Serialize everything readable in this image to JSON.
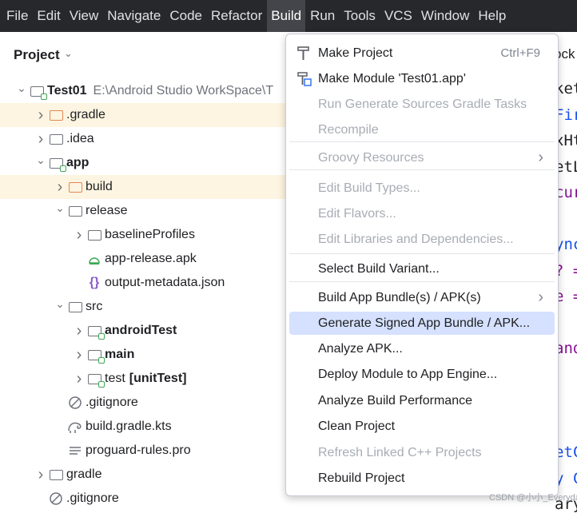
{
  "menubar": {
    "items": [
      "File",
      "Edit",
      "View",
      "Navigate",
      "Code",
      "Refactor",
      "Build",
      "Run",
      "Tools",
      "VCS",
      "Window",
      "Help"
    ],
    "active": "Build"
  },
  "project_panel": {
    "title": "Project",
    "tree": [
      {
        "label": "Test01",
        "path": "E:\\Android Studio WorkSpace\\T",
        "bold": true,
        "icon": "module-folder",
        "arrow": "down",
        "indent": 0,
        "highlight": false
      },
      {
        "label": ".gradle",
        "icon": "folder-orange",
        "arrow": "right",
        "indent": 1,
        "highlight": true
      },
      {
        "label": ".idea",
        "icon": "folder",
        "arrow": "right",
        "indent": 1,
        "highlight": false
      },
      {
        "label": "app",
        "bold": true,
        "icon": "module-folder",
        "arrow": "down",
        "indent": 1,
        "highlight": false
      },
      {
        "label": "build",
        "icon": "folder-orange",
        "arrow": "right",
        "indent": 2,
        "highlight": true
      },
      {
        "label": "release",
        "icon": "folder",
        "arrow": "down",
        "indent": 2,
        "highlight": false
      },
      {
        "label": "baselineProfiles",
        "icon": "folder",
        "arrow": "right",
        "indent": 3,
        "highlight": false
      },
      {
        "label": "app-release.apk",
        "icon": "apk-icon",
        "arrow": "",
        "indent": 3,
        "highlight": false
      },
      {
        "label": "output-metadata.json",
        "icon": "json-icon",
        "arrow": "",
        "indent": 3,
        "highlight": false
      },
      {
        "label": "src",
        "icon": "folder",
        "arrow": "down",
        "indent": 2,
        "highlight": false
      },
      {
        "label": "androidTest",
        "bold": true,
        "icon": "module-folder",
        "arrow": "right",
        "indent": 3,
        "highlight": false
      },
      {
        "label": "main",
        "bold": true,
        "icon": "module-folder",
        "arrow": "right",
        "indent": 3,
        "highlight": false
      },
      {
        "label": "test",
        "suffix": "[unitTest]",
        "icon": "module-folder",
        "arrow": "right",
        "indent": 3,
        "highlight": false
      },
      {
        "label": ".gitignore",
        "icon": "ignore-icon",
        "arrow": "",
        "indent": 2,
        "highlight": false
      },
      {
        "label": "build.gradle.kts",
        "icon": "gradle-icon",
        "arrow": "",
        "indent": 2,
        "highlight": false
      },
      {
        "label": "proguard-rules.pro",
        "icon": "text-file-icon",
        "arrow": "",
        "indent": 2,
        "highlight": false
      },
      {
        "label": "gradle",
        "icon": "folder",
        "arrow": "right",
        "indent": 1,
        "highlight": false
      },
      {
        "label": ".gitignore",
        "icon": "ignore-icon",
        "arrow": "",
        "indent": 1,
        "highlight": false
      }
    ]
  },
  "editor_peek": {
    "tab": "ock",
    "lines": [
      "ket",
      "Fir",
      "xHt",
      "etL",
      "cur",
      "",
      "ync",
      "? =",
      "e =",
      "",
      "and",
      "",
      "",
      "",
      "etC",
      "y C",
      "ary"
    ]
  },
  "build_menu": {
    "items": [
      {
        "label": "Make Project",
        "shortcut": "Ctrl+F9",
        "icon": "hammer-icon",
        "disabled": false
      },
      {
        "label": "Make Module 'Test01.app'",
        "icon": "make-module-icon",
        "disabled": false
      },
      {
        "label": "Run Generate Sources Gradle Tasks",
        "disabled": true
      },
      {
        "label": "Recompile",
        "disabled": true
      },
      {
        "sep": true
      },
      {
        "label": "Groovy Resources",
        "submenu": true,
        "disabled": true
      },
      {
        "sep": true
      },
      {
        "label": "Edit Build Types...",
        "disabled": true
      },
      {
        "label": "Edit Flavors...",
        "disabled": true
      },
      {
        "label": "Edit Libraries and Dependencies...",
        "disabled": true
      },
      {
        "sep": true
      },
      {
        "label": "Select Build Variant...",
        "disabled": false
      },
      {
        "sep": true
      },
      {
        "label": "Build App Bundle(s) / APK(s)",
        "submenu": true,
        "disabled": false
      },
      {
        "label": "Generate Signed App Bundle / APK...",
        "selected": true,
        "disabled": false
      },
      {
        "label": "Analyze APK...",
        "disabled": false
      },
      {
        "label": "Deploy Module to App Engine...",
        "disabled": false
      },
      {
        "label": "Analyze Build Performance",
        "disabled": false
      },
      {
        "label": "Clean Project",
        "disabled": false
      },
      {
        "label": "Refresh Linked C++ Projects",
        "disabled": true
      },
      {
        "label": "Rebuild Project",
        "disabled": false
      }
    ]
  },
  "watermark": "CSDN @小小_Everyday",
  "colors": {
    "menubar_bg": "#27282c",
    "highlight_row": "#fdf5e1",
    "menu_selection": "#d5e1fe",
    "disabled_text": "#a8acb3"
  }
}
